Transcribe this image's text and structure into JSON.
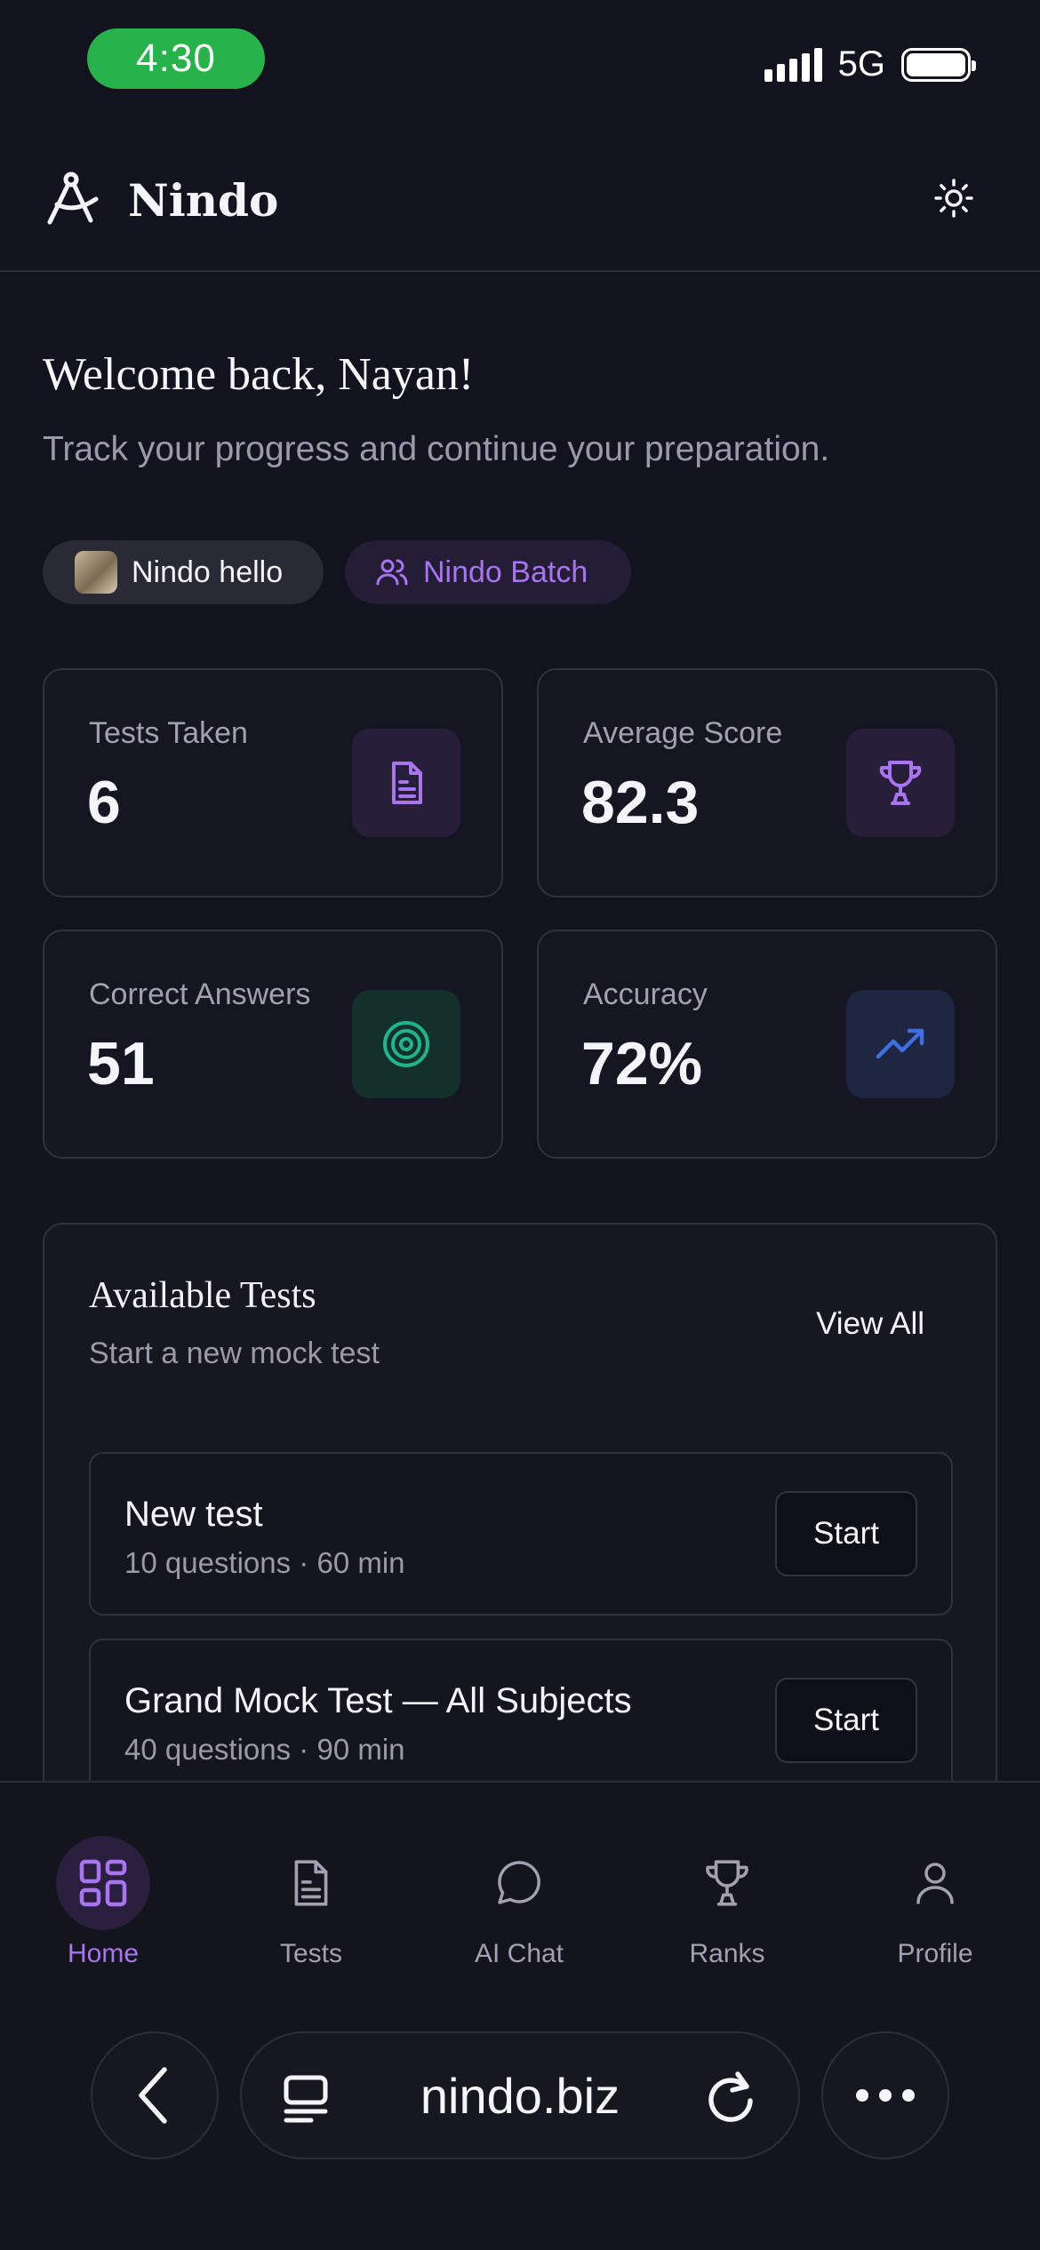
{
  "status_bar": {
    "time": "4:30",
    "network": "5G"
  },
  "header": {
    "brand": "Nindo"
  },
  "welcome": {
    "title": "Welcome back, Nayan!",
    "subtitle": "Track your progress and continue your preparation."
  },
  "chips": {
    "user": "Nindo hello",
    "batch": "Nindo Batch"
  },
  "stats": [
    {
      "label": "Tests Taken",
      "value": "6",
      "icon": "document-icon",
      "color": "#a974f1"
    },
    {
      "label": "Average Score",
      "value": "82.3",
      "icon": "trophy-icon",
      "color": "#a974f1"
    },
    {
      "label": "Correct Answers",
      "value": "51",
      "icon": "target-icon",
      "color": "#1fb58a"
    },
    {
      "label": "Accuracy",
      "value": "72%",
      "icon": "trending-up-icon",
      "color": "#3d6fe0"
    }
  ],
  "available_tests": {
    "title": "Available Tests",
    "subtitle": "Start a new mock test",
    "view_all": "View All",
    "items": [
      {
        "name": "New test",
        "meta": "10 questions · 60 min",
        "action": "Start"
      },
      {
        "name": "Grand Mock Test — All Subjects",
        "meta": "40 questions · 90 min",
        "action": "Start"
      }
    ]
  },
  "nav": [
    {
      "label": "Home",
      "icon": "home-grid-icon",
      "active": true
    },
    {
      "label": "Tests",
      "icon": "document-icon",
      "active": false
    },
    {
      "label": "AI Chat",
      "icon": "chat-bubble-icon",
      "active": false
    },
    {
      "label": "Ranks",
      "icon": "trophy-icon",
      "active": false
    },
    {
      "label": "Profile",
      "icon": "user-icon",
      "active": false
    }
  ],
  "browser": {
    "url": "nindo.biz"
  },
  "colors": {
    "accent": "#a974f1",
    "background": "#131320",
    "status_green": "#27b34a"
  }
}
